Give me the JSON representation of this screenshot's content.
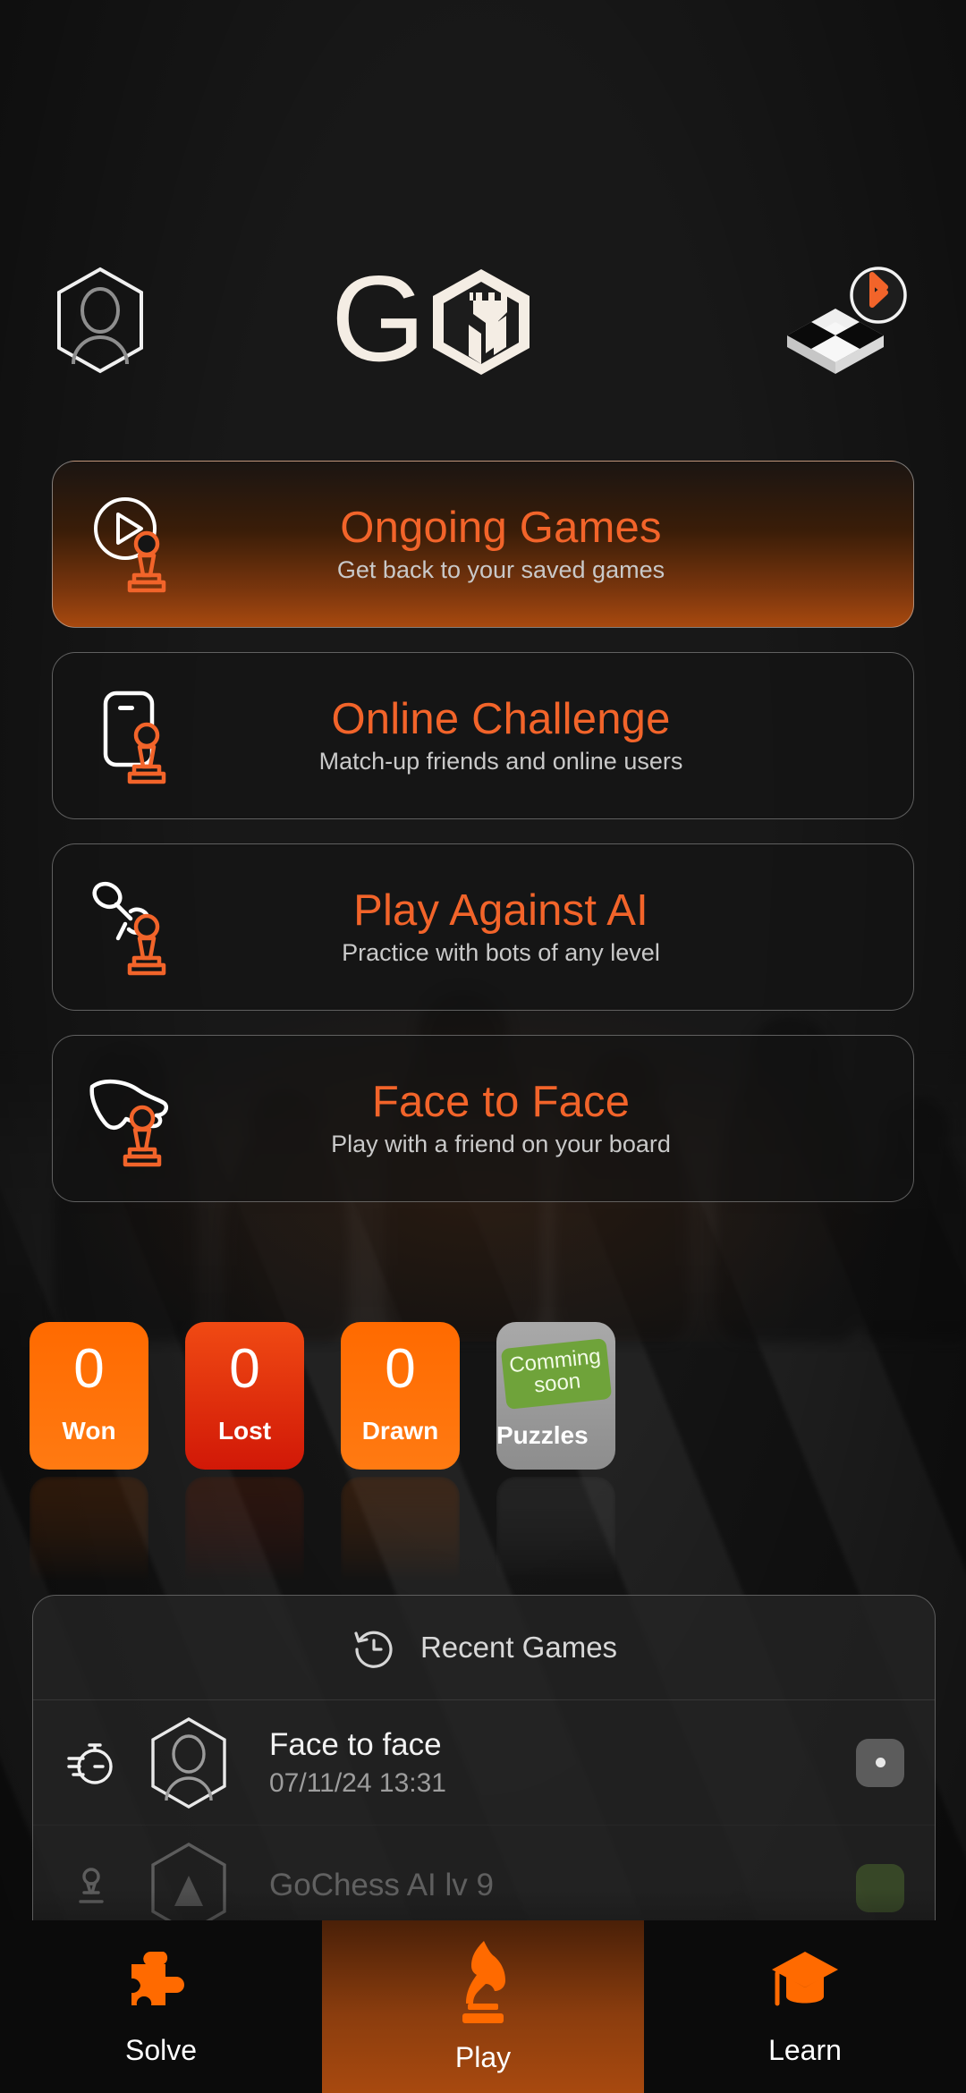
{
  "header": {
    "profile_icon": "person-hexagon-icon",
    "logo_text": "GO",
    "logo_icon": "gochess-rook-hexagon-logo",
    "board_icon": "chessboard-bluetooth-icon"
  },
  "menu": {
    "cards": [
      {
        "icon": "play-circle-pawn-icon",
        "title": "Ongoing Games",
        "subtitle": "Get back to your saved games",
        "active": true
      },
      {
        "icon": "phone-pawn-icon",
        "title": "Online Challenge",
        "subtitle": "Match-up friends and online users",
        "active": false
      },
      {
        "icon": "robot-arm-pawn-icon",
        "title": "Play Against AI",
        "subtitle": "Practice with bots of any level",
        "active": false
      },
      {
        "icon": "hand-pointing-pawn-icon",
        "title": "Face to Face",
        "subtitle": "Play with a friend on your board",
        "active": false
      }
    ]
  },
  "stats": [
    {
      "value": "0",
      "label": "Won",
      "variant": "won"
    },
    {
      "value": "0",
      "label": "Lost",
      "variant": "lost"
    },
    {
      "value": "0",
      "label": "Drawn",
      "variant": "drawn"
    },
    {
      "value": "",
      "label": "Puzzles",
      "variant": "puzzles",
      "ribbon": "Comming soon"
    }
  ],
  "recent_games": {
    "header_label": "Recent Games",
    "header_icon": "history-clock-icon",
    "rows": [
      {
        "mode_icon": "stopwatch-icon",
        "avatar_icon": "person-hexagon-icon",
        "title": "Face to face",
        "date": "07/11/24 13:31",
        "badge": "result-dot-badge",
        "badge_color": "#5c5c5c"
      },
      {
        "mode_icon": "robot-pawn-icon",
        "avatar_icon": "bot-hexagon-icon",
        "title": "GoChess AI lv 9",
        "date": "",
        "badge": "result-badge",
        "badge_color": "#6FA33A"
      }
    ]
  },
  "bottom_nav": {
    "items": [
      {
        "icon": "puzzle-piece-icon",
        "label": "Solve",
        "active": false
      },
      {
        "icon": "knight-chess-icon",
        "label": "Play",
        "active": true
      },
      {
        "icon": "graduation-cap-icon",
        "label": "Learn",
        "active": false
      }
    ]
  },
  "colors": {
    "accent_orange": "#F2642A",
    "tile_orange": "#FF6A00",
    "tile_red": "#D11807",
    "ribbon_green": "#6FA33A",
    "page_background": "#181818",
    "card_border": "#BEBEBE"
  }
}
